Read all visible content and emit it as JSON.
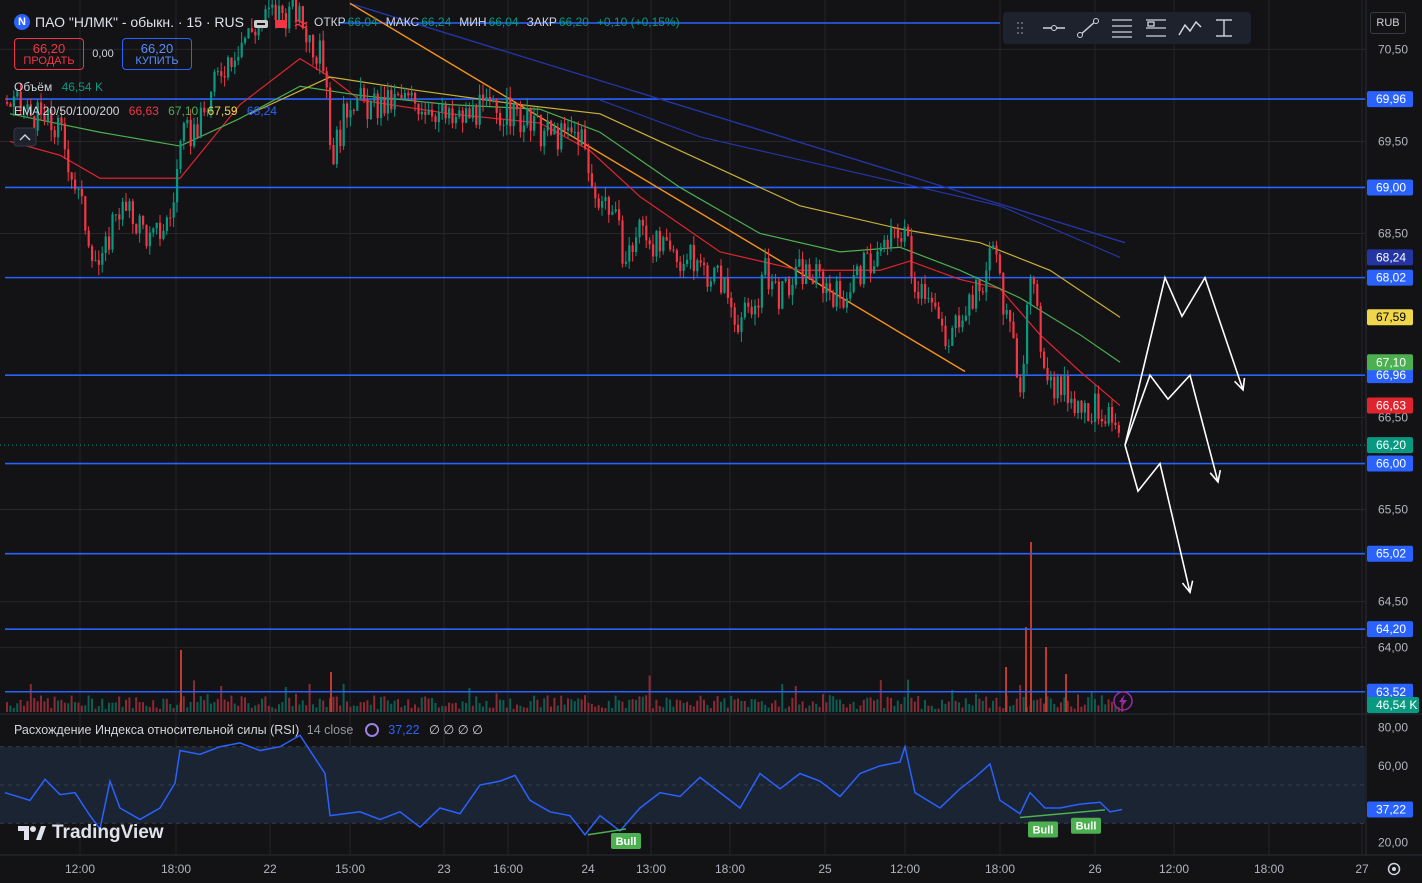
{
  "header": {
    "symbol_line": "ПАО \"НЛМК\" - обыкн. · 15 · RUS",
    "ohlc": [
      {
        "k": "ОТКР",
        "v": "66,04"
      },
      {
        "k": "МАКС",
        "v": "66,24"
      },
      {
        "k": "МИН",
        "v": "66,04"
      },
      {
        "k": "ЗАКР",
        "v": "66,20"
      }
    ],
    "change": "+0,10 (+0,15%)"
  },
  "trade": {
    "sell_price": "66,20",
    "sell_label": "ПРОДАТЬ",
    "spread": "0,00",
    "buy_price": "66,20",
    "buy_label": "КУПИТЬ"
  },
  "legend": {
    "volume_label": "Объём",
    "volume_value": "46,54 K",
    "ema_label": "EMA 20/50/100/200",
    "ema_values": [
      "66,63",
      "67,10",
      "67,59",
      "68,24"
    ]
  },
  "rsi_panel": {
    "title": "Расхождение Индекса относительной силы (RSI)",
    "params": "14 close",
    "value": "37,22",
    "extras": "∅ ∅ ∅ ∅"
  },
  "currency": "RUB",
  "branding": "TradingView",
  "colors": {
    "background": "#131316",
    "grid": "#26262b",
    "up": "#089981",
    "down": "#f23645",
    "hline": "#2962ff",
    "ema20": "#e0242f",
    "ema50": "#4caf50",
    "ema100": "#c9b037",
    "ema200": "#2434a3",
    "rsi": "#2962ff",
    "rsi_band": "#1b2433",
    "bull": "#4caf50",
    "arrows": "#ffffff",
    "trendline": "#f7931a"
  },
  "chart_data": [
    {
      "type": "candlestick",
      "title": "ПАО \"НЛМК\" - обыкн. · 15 · RUS",
      "ylim": [
        63.3,
        70.95
      ],
      "y_ticks": [
        "70,50",
        "69,50",
        "68,50",
        "66,50",
        "65,50",
        "64,50",
        "64,00"
      ],
      "x_ticks": [
        "12:00",
        "18:00",
        "22",
        "15:00",
        "23",
        "16:00",
        "24",
        "13:00",
        "18:00",
        "25",
        "12:00",
        "18:00",
        "26",
        "12:00",
        "18:00",
        "27"
      ],
      "close_path": [
        [
          0,
          69.96
        ],
        [
          30,
          69.8
        ],
        [
          60,
          69.6
        ],
        [
          90,
          68.4
        ],
        [
          100,
          68.1
        ],
        [
          115,
          68.8
        ],
        [
          140,
          68.6
        ],
        [
          150,
          68.4
        ],
        [
          170,
          68.7
        ],
        [
          180,
          69.5
        ],
        [
          200,
          69.7
        ],
        [
          220,
          70.3
        ],
        [
          240,
          70.6
        ],
        [
          270,
          70.9
        ],
        [
          295,
          70.9
        ],
        [
          310,
          70.6
        ],
        [
          325,
          70.3
        ],
        [
          330,
          69.3
        ],
        [
          350,
          70.0
        ],
        [
          370,
          69.85
        ],
        [
          400,
          69.95
        ],
        [
          430,
          69.9
        ],
        [
          450,
          69.7
        ],
        [
          480,
          69.85
        ],
        [
          510,
          69.8
        ],
        [
          540,
          69.6
        ],
        [
          560,
          69.55
        ],
        [
          580,
          69.6
        ],
        [
          590,
          69.0
        ],
        [
          610,
          68.8
        ],
        [
          625,
          68.2
        ],
        [
          640,
          68.6
        ],
        [
          660,
          68.3
        ],
        [
          690,
          68.2
        ],
        [
          720,
          68.0
        ],
        [
          735,
          67.6
        ],
        [
          750,
          67.6
        ],
        [
          765,
          68.1
        ],
        [
          780,
          67.8
        ],
        [
          800,
          68.1
        ],
        [
          820,
          68.0
        ],
        [
          840,
          67.8
        ],
        [
          860,
          68.1
        ],
        [
          880,
          68.3
        ],
        [
          905,
          68.6
        ],
        [
          910,
          68.0
        ],
        [
          930,
          67.9
        ],
        [
          945,
          67.2
        ],
        [
          960,
          67.7
        ],
        [
          980,
          67.9
        ],
        [
          995,
          68.5
        ],
        [
          1000,
          67.8
        ],
        [
          1010,
          67.4
        ],
        [
          1020,
          66.9
        ],
        [
          1030,
          68.0
        ],
        [
          1040,
          67.3
        ],
        [
          1050,
          66.9
        ],
        [
          1065,
          66.8
        ],
        [
          1085,
          66.6
        ],
        [
          1100,
          66.6
        ],
        [
          1110,
          66.4
        ],
        [
          1120,
          66.2
        ]
      ],
      "ema": [
        {
          "name": "EMA 20",
          "last": 66.63,
          "path": [
            [
              10,
              69.5
            ],
            [
              60,
              69.35
            ],
            [
              100,
              69.1
            ],
            [
              180,
              69.1
            ],
            [
              240,
              69.9
            ],
            [
              300,
              70.4
            ],
            [
              330,
              70.2
            ],
            [
              360,
              69.95
            ],
            [
              450,
              69.8
            ],
            [
              540,
              69.7
            ],
            [
              590,
              69.4
            ],
            [
              640,
              68.9
            ],
            [
              720,
              68.3
            ],
            [
              800,
              68.1
            ],
            [
              880,
              68.1
            ],
            [
              910,
              68.2
            ],
            [
              960,
              68.0
            ],
            [
              1000,
              67.9
            ],
            [
              1040,
              67.4
            ],
            [
              1080,
              67.0
            ],
            [
              1120,
              66.63
            ]
          ]
        },
        {
          "name": "EMA 50",
          "last": 67.1,
          "path": [
            [
              10,
              69.8
            ],
            [
              100,
              69.6
            ],
            [
              180,
              69.45
            ],
            [
              240,
              69.75
            ],
            [
              300,
              70.1
            ],
            [
              360,
              70.0
            ],
            [
              450,
              69.9
            ],
            [
              540,
              69.85
            ],
            [
              600,
              69.6
            ],
            [
              680,
              69.0
            ],
            [
              760,
              68.5
            ],
            [
              840,
              68.3
            ],
            [
              900,
              68.35
            ],
            [
              960,
              68.1
            ],
            [
              1020,
              67.8
            ],
            [
              1080,
              67.4
            ],
            [
              1120,
              67.1
            ]
          ]
        },
        {
          "name": "EMA 100",
          "last": 67.59,
          "path": [
            [
              250,
              69.8
            ],
            [
              330,
              70.2
            ],
            [
              420,
              70.05
            ],
            [
              520,
              69.9
            ],
            [
              600,
              69.8
            ],
            [
              700,
              69.3
            ],
            [
              800,
              68.8
            ],
            [
              900,
              68.55
            ],
            [
              980,
              68.4
            ],
            [
              1050,
              68.1
            ],
            [
              1120,
              67.59
            ]
          ]
        },
        {
          "name": "EMA 200",
          "last": 68.24,
          "path": [
            [
              600,
              69.95
            ],
            [
              700,
              69.55
            ],
            [
              800,
              69.3
            ],
            [
              900,
              69.05
            ],
            [
              1000,
              68.8
            ],
            [
              1120,
              68.24
            ]
          ]
        }
      ],
      "horizontal_levels": [
        69.96,
        69.0,
        68.02,
        66.96,
        66.0,
        65.02,
        64.2,
        63.52
      ],
      "price_tags": [
        {
          "label": "68,24",
          "value": 68.24,
          "color": "#2434a3"
        },
        {
          "label": "67,59",
          "value": 67.59,
          "color": "#f0d64a"
        },
        {
          "label": "67,10",
          "value": 67.1,
          "color": "#4caf50"
        },
        {
          "label": "66,63",
          "value": 66.63,
          "color": "#e0242f"
        },
        {
          "label": "66,20",
          "value": 66.2,
          "color": "#089981"
        }
      ],
      "trendline_orange": [
        [
          350,
          71.0
        ],
        [
          965,
          67.0
        ]
      ],
      "trendline_blue": [
        [
          350,
          71.0
        ],
        [
          1125,
          68.4
        ]
      ],
      "scenario_arrows": [
        [
          [
            1125,
            66.2
          ],
          [
            1165,
            68.02
          ],
          [
            1182,
            67.6
          ],
          [
            1205,
            68.02
          ],
          [
            1243,
            66.8
          ]
        ],
        [
          [
            1125,
            66.2
          ],
          [
            1150,
            66.96
          ],
          [
            1168,
            66.7
          ],
          [
            1190,
            66.96
          ],
          [
            1218,
            65.8
          ]
        ],
        [
          [
            1125,
            66.2
          ],
          [
            1138,
            65.7
          ],
          [
            1160,
            66.0
          ],
          [
            1190,
            64.6
          ]
        ]
      ]
    },
    {
      "type": "bar",
      "title": "Объём",
      "last_label": "46,54 K",
      "spikes": [
        [
          180,
          62
        ],
        [
          330,
          40
        ],
        [
          1030,
          170
        ],
        [
          1025,
          85
        ],
        [
          1045,
          65
        ],
        [
          1065,
          38
        ],
        [
          1005,
          45
        ]
      ]
    },
    {
      "type": "line",
      "title": "Расхождение Индекса относительной силы (RSI)",
      "ylim": [
        15,
        85
      ],
      "y_ticks": [
        "80,00",
        "60,00",
        "20,00"
      ],
      "bands": [
        30,
        50,
        70
      ],
      "values": [
        [
          5,
          46
        ],
        [
          30,
          42
        ],
        [
          45,
          53
        ],
        [
          60,
          45
        ],
        [
          75,
          46
        ],
        [
          90,
          34
        ],
        [
          100,
          27
        ],
        [
          110,
          52
        ],
        [
          120,
          38
        ],
        [
          140,
          32
        ],
        [
          160,
          38
        ],
        [
          175,
          51
        ],
        [
          180,
          68
        ],
        [
          200,
          66
        ],
        [
          220,
          70
        ],
        [
          240,
          72
        ],
        [
          260,
          68
        ],
        [
          280,
          70
        ],
        [
          300,
          76
        ],
        [
          310,
          68
        ],
        [
          325,
          56
        ],
        [
          330,
          34
        ],
        [
          360,
          36
        ],
        [
          380,
          32
        ],
        [
          400,
          36
        ],
        [
          420,
          28
        ],
        [
          440,
          38
        ],
        [
          460,
          35
        ],
        [
          480,
          50
        ],
        [
          500,
          52
        ],
        [
          515,
          55
        ],
        [
          530,
          42
        ],
        [
          550,
          36
        ],
        [
          570,
          34
        ],
        [
          585,
          24
        ],
        [
          600,
          34
        ],
        [
          620,
          26
        ],
        [
          640,
          38
        ],
        [
          660,
          46
        ],
        [
          680,
          44
        ],
        [
          700,
          54
        ],
        [
          720,
          46
        ],
        [
          740,
          38
        ],
        [
          760,
          56
        ],
        [
          780,
          48
        ],
        [
          800,
          56
        ],
        [
          820,
          52
        ],
        [
          840,
          44
        ],
        [
          860,
          56
        ],
        [
          880,
          60
        ],
        [
          900,
          62
        ],
        [
          905,
          70
        ],
        [
          915,
          46
        ],
        [
          940,
          38
        ],
        [
          960,
          48
        ],
        [
          975,
          54
        ],
        [
          990,
          61
        ],
        [
          1000,
          42
        ],
        [
          1020,
          35
        ],
        [
          1030,
          46
        ],
        [
          1045,
          38
        ],
        [
          1060,
          38
        ],
        [
          1080,
          40
        ],
        [
          1100,
          41
        ],
        [
          1110,
          36
        ],
        [
          1122,
          37.22
        ]
      ],
      "last_label": "37,22",
      "divergence_labels": [
        {
          "text": "Bull",
          "at": [
            626,
            27
          ]
        },
        {
          "text": "Bull",
          "at": [
            1043,
            33
          ]
        },
        {
          "text": "Bull",
          "at": [
            1086,
            35
          ]
        }
      ]
    }
  ]
}
